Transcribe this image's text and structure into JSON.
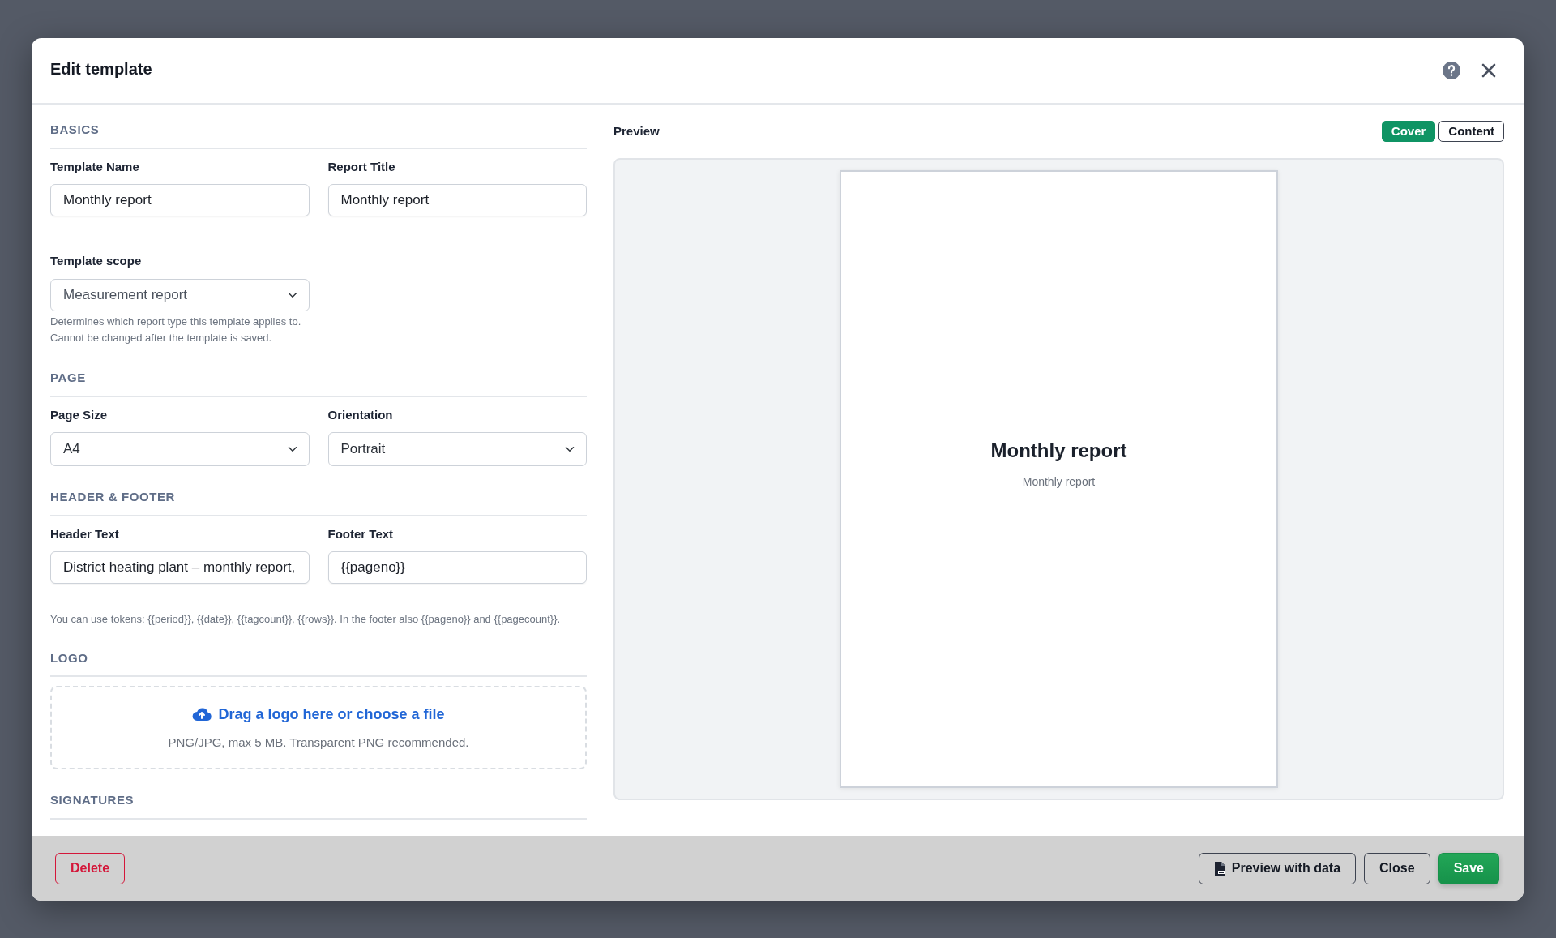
{
  "dialog": {
    "title": "Edit template"
  },
  "sections": [
    {
      "heading": "BASICS",
      "items": [
        {
          "kind": "input",
          "label": "Template Name",
          "value": "Monthly report"
        },
        {
          "kind": "input",
          "label": "Report Title",
          "value": "Monthly report"
        },
        {
          "kind": "select",
          "label": "Template scope",
          "value": "Measurement report",
          "help": "Determines which report type this template applies to. Cannot be changed after the template is saved."
        }
      ]
    },
    {
      "heading": "PAGE",
      "items": [
        {
          "kind": "select",
          "label": "Page Size",
          "value": "A4"
        },
        {
          "kind": "select",
          "label": "Orientation",
          "value": "Portrait"
        }
      ]
    },
    {
      "heading": "HEADER & FOOTER",
      "items": [
        {
          "kind": "input",
          "label": "Header Text",
          "value": "District heating plant – monthly report,"
        },
        {
          "kind": "input",
          "label": "Footer Text",
          "value": "{{pageno}}"
        },
        {
          "kind": "note",
          "text": "You can use tokens: {{period}}, {{date}}, {{tagcount}}, {{rows}}. In the footer also {{pageno}} and {{pagecount}}."
        }
      ]
    },
    {
      "heading": "LOGO",
      "items": [
        {
          "kind": "dropzone",
          "link": "Drag a logo here or choose a file",
          "hint": "PNG/JPG, max 5 MB. Transparent PNG recommended."
        }
      ]
    },
    {
      "heading": "SIGNATURES"
    }
  ],
  "preview": {
    "label": "Preview",
    "tabs": [
      {
        "label": "Cover",
        "selected": true
      },
      {
        "label": "Content",
        "selected": false
      }
    ],
    "page": {
      "title": "Monthly report",
      "subtitle": "Monthly report"
    }
  },
  "footer": {
    "buttons": [
      {
        "kind": "danger",
        "label": "Delete"
      },
      {
        "kind": "pdf",
        "label": "Preview with data"
      },
      {
        "kind": "outline",
        "label": "Close"
      },
      {
        "kind": "primary",
        "label": "Save"
      }
    ]
  }
}
